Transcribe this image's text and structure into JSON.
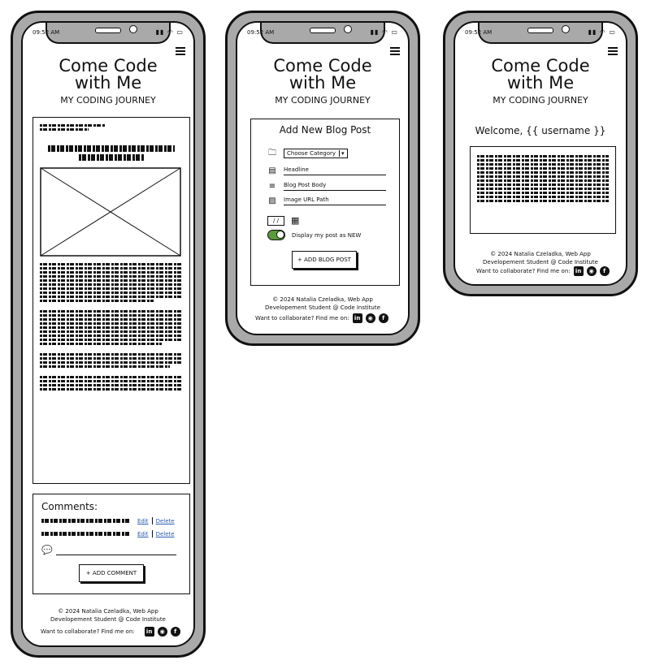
{
  "status_bar": {
    "time": "09:52 AM",
    "icons": "signal wifi battery"
  },
  "site": {
    "title_line1": "Come Code",
    "title_line2": "with Me",
    "subtitle": "MY CODING JOURNEY"
  },
  "post_screen": {
    "comments_title": "Comments:",
    "edit_label": "Edit",
    "delete_label": "Delete",
    "add_comment_label": "+ ADD COMMENT"
  },
  "form_screen": {
    "heading": "Add New Blog Post",
    "category_select": "Choose Category",
    "headline_placeholder": "Headline",
    "body_placeholder": "Blog Post Body",
    "image_placeholder": "Image URL Path",
    "date_value": "/ /",
    "new_toggle_label": "Display my post as NEW",
    "submit_label": "+ ADD BLOG POST"
  },
  "welcome_screen": {
    "welcome_text": "Welcome, {{ username }}"
  },
  "footer": {
    "line1": "© 2024 Natalia Czeladka, Web App",
    "line2": "Developement Student @ Code Institute",
    "collab": "Want to collaborate? Find me on:",
    "social": [
      "linkedin-icon",
      "github-icon",
      "facebook-icon"
    ]
  },
  "colors": {
    "toggle_on": "#5a9a3c",
    "link": "#2a5db0",
    "frame": "#a9a9a9"
  }
}
